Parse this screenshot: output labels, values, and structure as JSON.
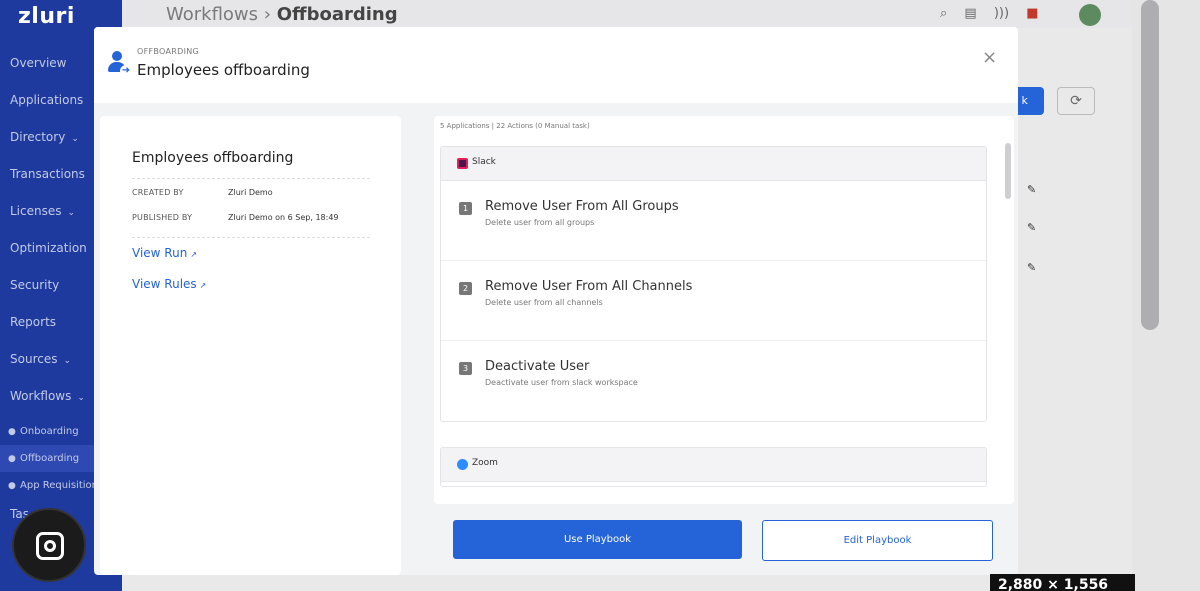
{
  "brand": {
    "logo_text": "zluri"
  },
  "sidebar": {
    "items": [
      {
        "label": "Overview",
        "chev": ""
      },
      {
        "label": "Applications",
        "chev": ""
      },
      {
        "label": "Directory",
        "chev": "⌄"
      },
      {
        "label": "Transactions",
        "chev": ""
      },
      {
        "label": "Licenses",
        "chev": "⌄"
      },
      {
        "label": "Optimization",
        "chev": ""
      },
      {
        "label": "Security",
        "chev": ""
      },
      {
        "label": "Reports",
        "chev": ""
      },
      {
        "label": "Sources",
        "chev": "⌄"
      },
      {
        "label": "Workflows",
        "chev": "⌄"
      }
    ],
    "subitems": [
      {
        "label": "Onboarding",
        "active": false
      },
      {
        "label": "Offboarding",
        "active": true
      },
      {
        "label": "App Requisition",
        "active": false
      }
    ],
    "truncated_item": "Tas"
  },
  "topbar": {
    "crumb_parent": "Workflows",
    "crumb_sep": "›",
    "crumb_current": "Offboarding",
    "icons": [
      "search-icon",
      "clipboard-icon",
      "feed-icon",
      "notification-icon"
    ]
  },
  "modal": {
    "kicker": "OFFBOARDING",
    "title": "Employees offboarding",
    "close": "×",
    "left": {
      "title": "Employees offboarding",
      "created_by_label": "CREATED BY",
      "created_by_value": "Zluri Demo",
      "published_by_label": "PUBLISHED BY",
      "published_by_value": "Zluri Demo on 6 Sep, 18:49",
      "view_run": "View Run",
      "view_rules": "View Rules",
      "ext_glyph": "↗"
    },
    "summary": "5 Applications | 22 Actions (0 Manual task)",
    "apps": [
      {
        "name": "Slack",
        "color": "#4a154b",
        "actions": [
          {
            "num": "1",
            "title": "Remove User From All Groups",
            "desc": "Delete user from all groups"
          },
          {
            "num": "2",
            "title": "Remove User From All Channels",
            "desc": "Delete user from all channels"
          },
          {
            "num": "3",
            "title": "Deactivate User",
            "desc": "Deactivate user from slack workspace"
          }
        ]
      },
      {
        "name": "Zoom",
        "color": "#2d8cff",
        "actions": []
      }
    ],
    "buttons": {
      "use": "Use Playbook",
      "edit": "Edit Playbook"
    }
  },
  "overlay": {
    "dimensions_label": "2,880 × 1,556"
  },
  "colors": {
    "primary": "#2563d9",
    "sidebar": "#1f3a9e"
  }
}
